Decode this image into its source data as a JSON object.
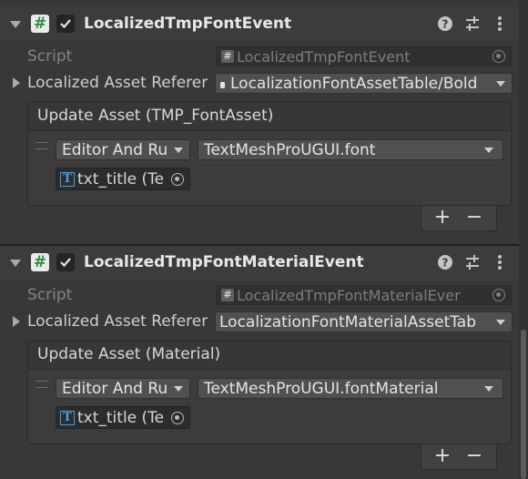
{
  "components": [
    {
      "title": "LocalizedTmpFontEvent",
      "script_label": "Script",
      "script_value": "LocalizedTmpFontEvent",
      "asset_ref_label": "Localized Asset Referer",
      "asset_ref_value": "LocalizationFontAssetTable/Bold",
      "event_title": "Update Asset (TMP_FontAsset)",
      "runtime_option": "Editor And Ru",
      "function_value": "TextMeshProUGUI.font",
      "target_object": "txt_title (Te"
    },
    {
      "title": "LocalizedTmpFontMaterialEvent",
      "script_label": "Script",
      "script_value": "LocalizedTmpFontMaterialEver",
      "asset_ref_label": "Localized Asset Referer",
      "asset_ref_value": "LocalizationFontMaterialAssetTab",
      "event_title": "Update Asset (Material)",
      "runtime_option": "Editor And Ru",
      "function_value": "TextMeshProUGUI.fontMaterial",
      "target_object": "txt_title (Te"
    }
  ],
  "icons": {
    "script": "csharp-script-icon",
    "enabled": "checkbox-checked-icon",
    "help": "help-icon",
    "presets": "presets-sliders-icon",
    "menu": "kebab-menu-icon",
    "picker": "object-picker-icon",
    "text_component": "tmp-text-icon"
  },
  "glyphs": {
    "hash": "#",
    "tmp": "T",
    "plus": "+",
    "minus": "−"
  },
  "colors": {
    "background": "#383838",
    "header": "#3c3c3c",
    "script_icon_green": "#2f8b3f",
    "tmp_blue": "#4a9ddc"
  }
}
